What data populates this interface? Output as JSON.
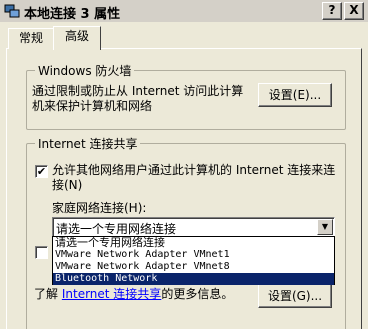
{
  "window": {
    "title": "本地连接 3 属性",
    "help_button": "?",
    "close_button": "X"
  },
  "tabs": [
    {
      "label": "常规"
    },
    {
      "label": "高级"
    }
  ],
  "firewall": {
    "group_title": "Windows 防火墙",
    "description": "通过限制或防止从 Internet 访问此计算机来保护计算机和网络",
    "settings_button": "设置(E)..."
  },
  "ics": {
    "group_title": "Internet 连接共享",
    "allow_checkbox_checked": true,
    "allow_label": "允许其他网络用户通过此计算机的 Internet 连接来连接(N)",
    "home_network_label": "家庭网络连接(H):",
    "combo_value": "请选一个专用网络连接",
    "dropdown_options": [
      "请选一个专用网络连接",
      "VMware Network Adapter VMnet1",
      "VMware Network Adapter VMnet8",
      "Bluetooth Network"
    ],
    "selected_option_index": 3,
    "footer_prefix": "了解",
    "footer_link": "Internet 连接共享",
    "footer_suffix": "的更多信息。",
    "settings_button": "设置(G)..."
  }
}
